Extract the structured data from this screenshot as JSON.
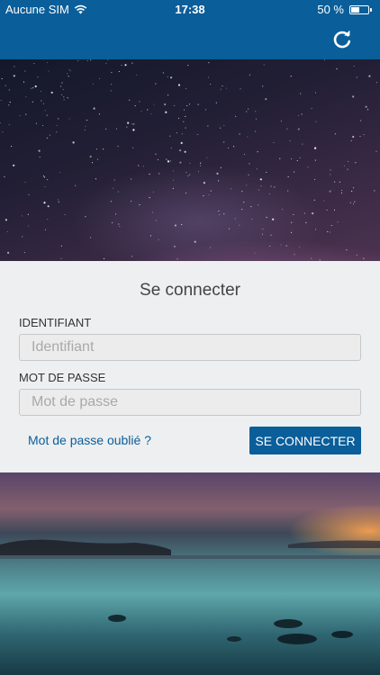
{
  "status_bar": {
    "carrier": "Aucune SIM",
    "time": "17:38",
    "battery_text": "50 %",
    "battery_level": 0.5,
    "wifi_icon": "wifi-icon"
  },
  "nav_bar": {
    "refresh_icon": "refresh-icon",
    "color": "#0a5e99"
  },
  "login": {
    "title": "Se connecter",
    "username_label": "IDENTIFIANT",
    "username_placeholder": "Identifiant",
    "username_value": "",
    "password_label": "MOT DE PASSE",
    "password_placeholder": "Mot de passe",
    "password_value": "",
    "forgot_link": "Mot de passe oublié ?",
    "submit_button": "SE CONNECTER"
  }
}
